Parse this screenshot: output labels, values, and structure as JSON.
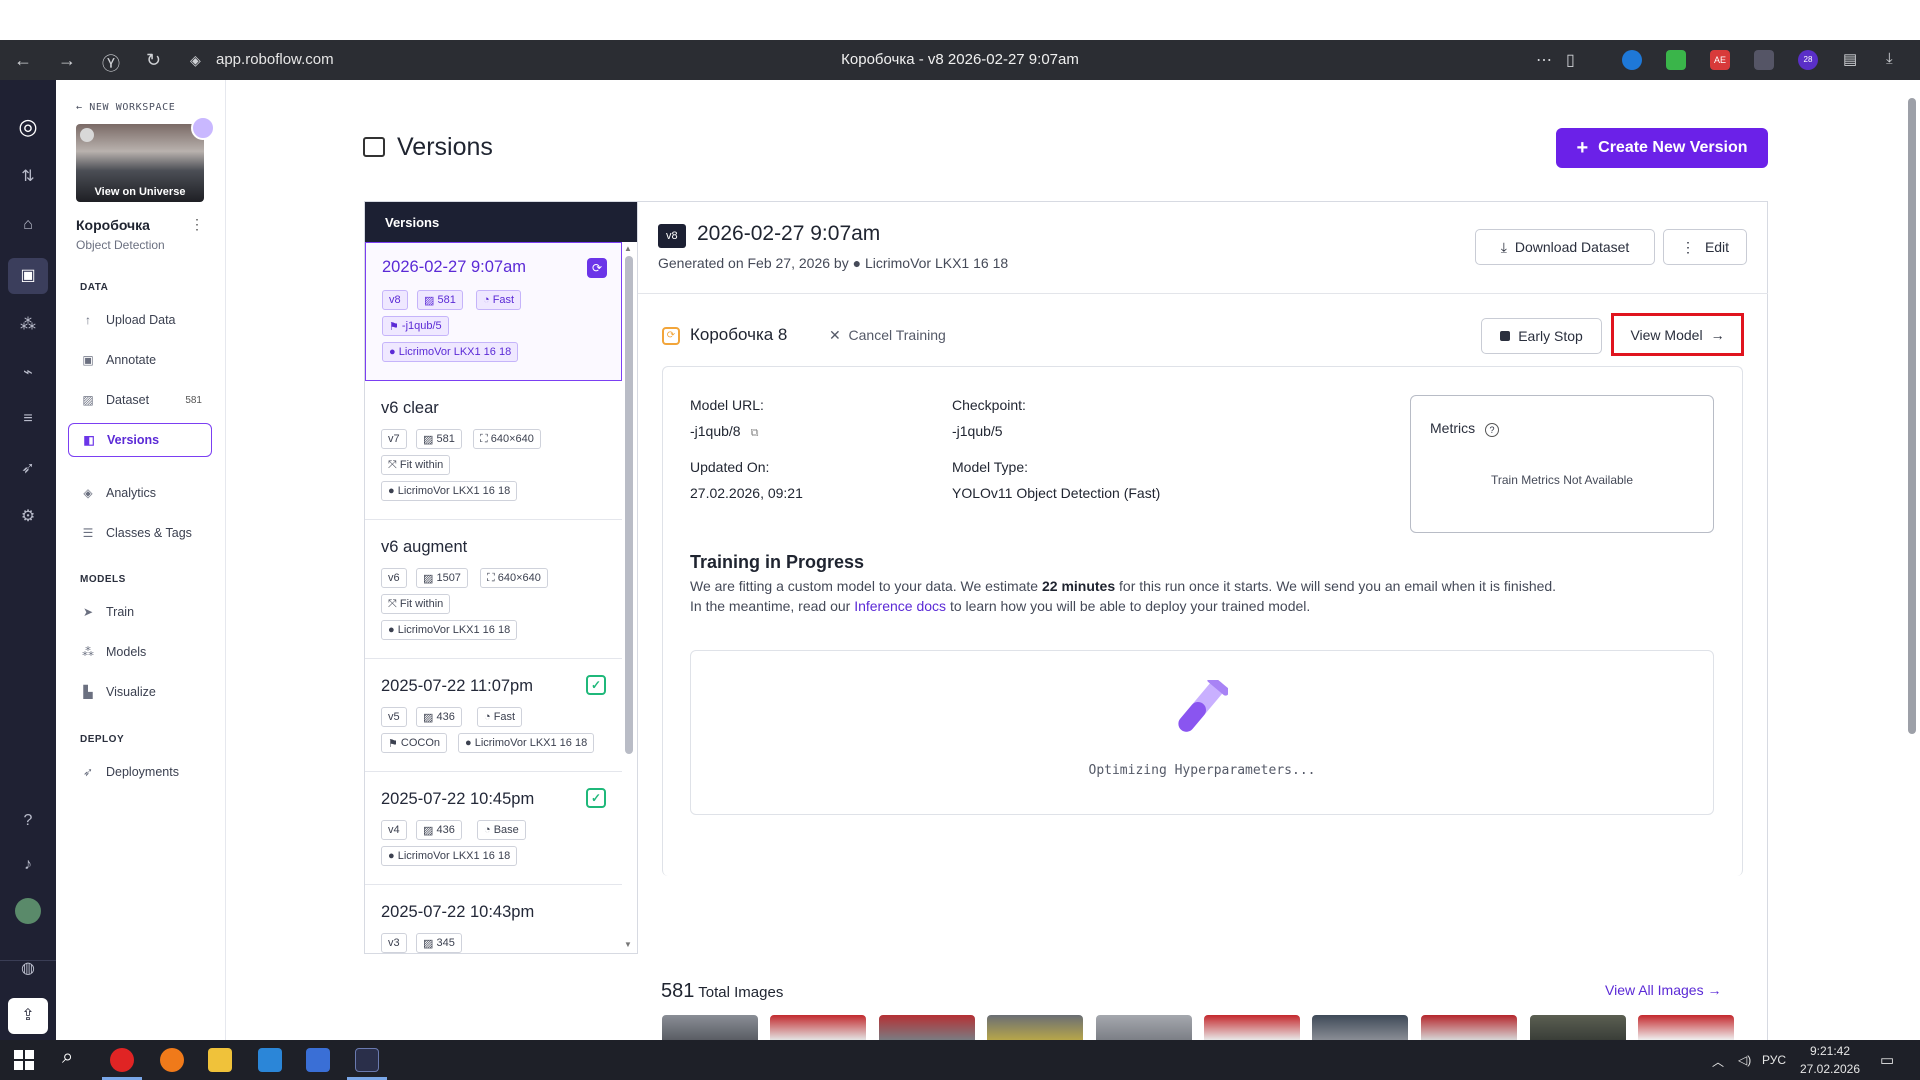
{
  "browser": {
    "url": "app.roboflow.com",
    "tab_title": "Коробочка - v8 2026-02-27 9:07am",
    "ext_badges": [
      "AE",
      "28"
    ]
  },
  "sidebar": {
    "back_label": "NEW WORKSPACE",
    "thumb_label": "View on Universe",
    "project_name": "Коробочка",
    "project_type": "Object Detection",
    "sections": {
      "data": "DATA",
      "models": "MODELS",
      "deploy": "DEPLOY"
    },
    "data_items": [
      {
        "label": "Upload Data",
        "icon": "upload-icon"
      },
      {
        "label": "Annotate",
        "icon": "annotate-icon"
      },
      {
        "label": "Dataset",
        "icon": "image-icon",
        "count": "581"
      },
      {
        "label": "Versions",
        "icon": "versions-icon"
      },
      {
        "label": "Analytics",
        "icon": "analytics-icon"
      },
      {
        "label": "Classes & Tags",
        "icon": "list-icon"
      }
    ],
    "model_items": [
      {
        "label": "Train",
        "icon": "train-icon"
      },
      {
        "label": "Models",
        "icon": "models-icon"
      },
      {
        "label": "Visualize",
        "icon": "chart-icon"
      }
    ],
    "deploy_items": [
      {
        "label": "Deployments",
        "icon": "rocket-icon"
      }
    ]
  },
  "page": {
    "title": "Versions",
    "create_button": "Create New Version"
  },
  "versions_list": {
    "header": "Versions",
    "items": [
      {
        "name": "2026-02-27 9:07am",
        "chips": [
          "v8",
          "581",
          "Fast",
          "-j1qub/5",
          "LicrimoVor LKX1 16 18"
        ]
      },
      {
        "name": "v6 clear",
        "chips": [
          "v7",
          "581",
          "640×640",
          "Fit within",
          "LicrimoVor LKX1 16 18"
        ]
      },
      {
        "name": "v6 augment",
        "chips": [
          "v6",
          "1507",
          "640×640",
          "Fit within",
          "LicrimoVor LKX1 16 18"
        ]
      },
      {
        "name": "2025-07-22 11:07pm",
        "chips": [
          "v5",
          "436",
          "Fast",
          "COCOn",
          "LicrimoVor LKX1 16 18"
        ]
      },
      {
        "name": "2025-07-22 10:45pm",
        "chips": [
          "v4",
          "436",
          "Base",
          "LicrimoVor LKX1 16 18"
        ]
      },
      {
        "name": "2025-07-22 10:43pm",
        "chips": [
          "v3",
          "345"
        ]
      }
    ]
  },
  "detail": {
    "version_tag": "v8",
    "title": "2026-02-27 9:07am",
    "generated_prefix": "Generated on Feb 27, 2026 by",
    "author": "LicrimoVor LKX1 16 18",
    "download_button": "Download Dataset",
    "edit_button": "Edit",
    "model_name": "Коробочка 8",
    "cancel_training": "Cancel Training",
    "early_stop": "Early Stop",
    "view_model": "View Model",
    "fields": {
      "model_url_label": "Model URL:",
      "model_url": "-j1qub/8",
      "checkpoint_label": "Checkpoint:",
      "checkpoint": "-j1qub/5",
      "updated_label": "Updated On:",
      "updated": "27.02.2026, 09:21",
      "model_type_label": "Model Type:",
      "model_type": "YOLOv11 Object Detection (Fast)"
    },
    "metrics_title": "Metrics",
    "metrics_empty": "Train Metrics Not Available",
    "training_title": "Training in Progress",
    "training_line1_a": "We are fitting a custom model to your data. We estimate",
    "training_line1_b": "22 minutes",
    "training_line1_c": "for this run once it starts. We will send you an email when it is finished.",
    "training_line2_a": "In the meantime, read our",
    "training_line2_link": "Inference docs",
    "training_line2_b": "to learn how you will be able to deploy your trained model.",
    "optimizing": "Optimizing Hyperparameters...",
    "total_count": "581",
    "total_label": "Total Images",
    "view_all": "View All Images"
  },
  "taskbar": {
    "lang": "РУС",
    "time": "9:21:42",
    "date": "27.02.2026"
  },
  "colors": {
    "accent": "#6b21e8",
    "rail": "#1f2133",
    "highlight": "#e0141e",
    "success": "#1fb87a"
  }
}
